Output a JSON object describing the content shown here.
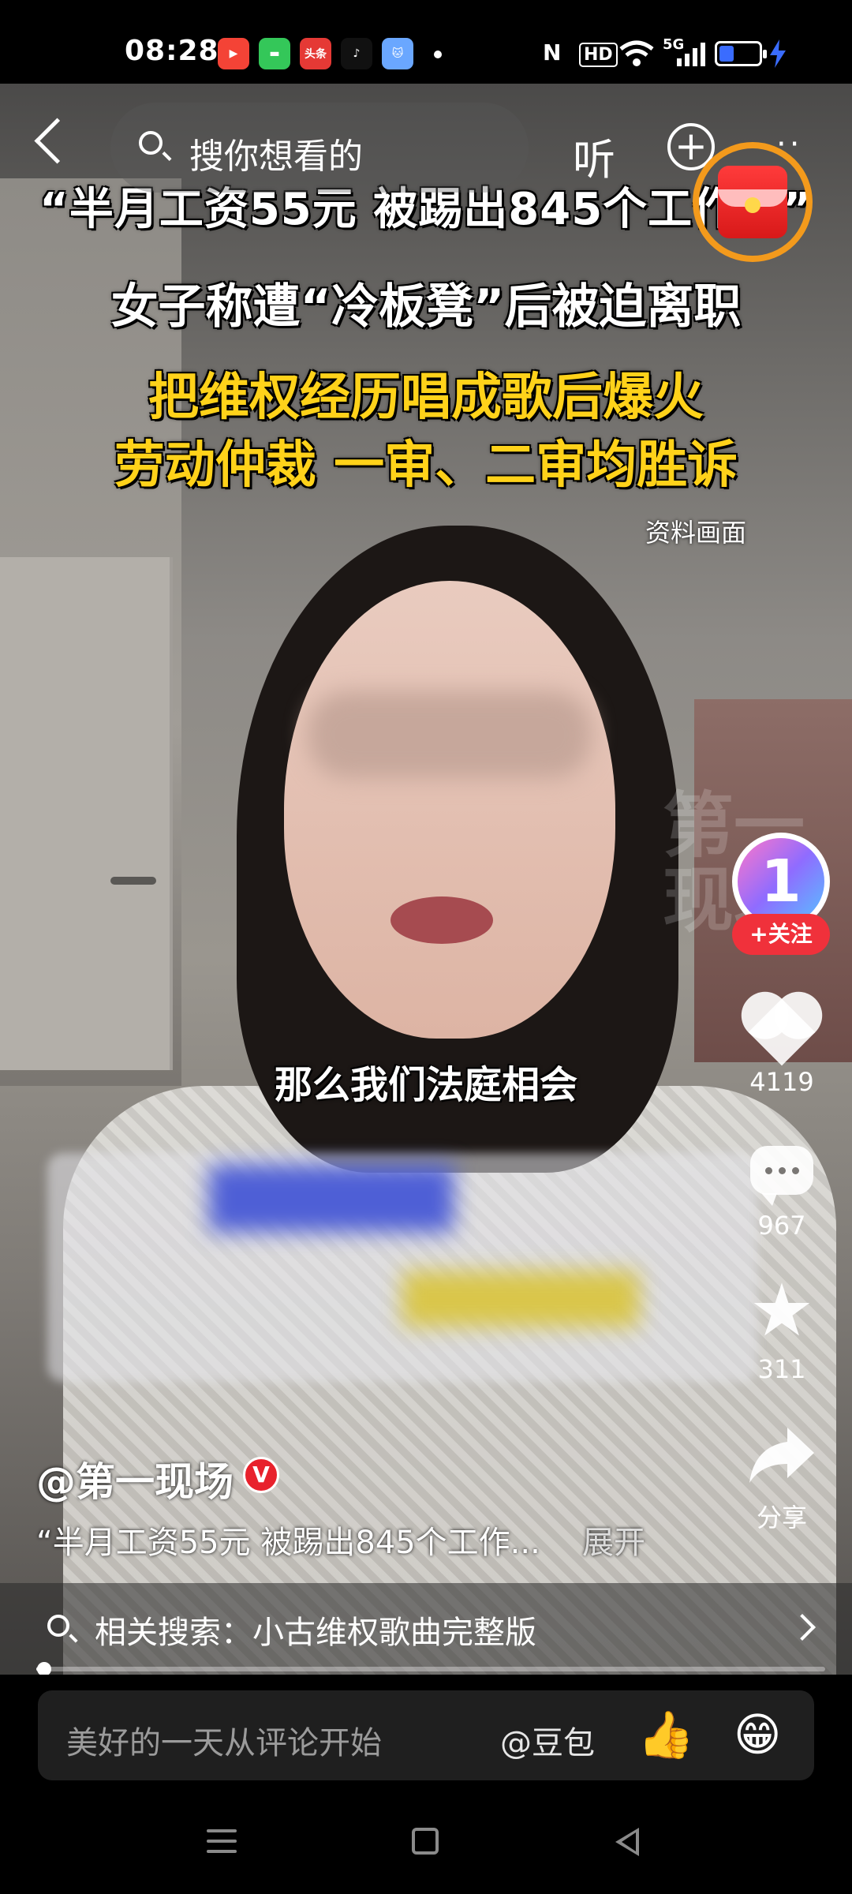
{
  "status_bar": {
    "time": "08:28",
    "app_icons": [
      {
        "name": "video-app-icon",
        "color": "#f44336",
        "label": "▶"
      },
      {
        "name": "message-app-icon",
        "color": "#34c759",
        "label": "▬"
      },
      {
        "name": "toutiao-app-icon",
        "color": "#e53935",
        "label": "头条"
      },
      {
        "name": "tiktok-app-icon",
        "color": "#111111",
        "label": "♪"
      },
      {
        "name": "cat-app-icon",
        "color": "#6aa7ff",
        "label": "🐱"
      }
    ],
    "nfc": "N",
    "hd": "HD",
    "signal": "5G"
  },
  "top_bar": {
    "search_placeholder": "搜你想看的",
    "listen_label": "听"
  },
  "video": {
    "headline_1": "“半月工资55元 被踢出845个工作群”",
    "headline_2": "女子称遭“冷板凳”后被迫离职",
    "headline_3": "把维权经历唱成歌后爆火",
    "headline_4": "劳动仲裁 一审、二审均胜诉",
    "tag": "资料画面",
    "subtitle": "那么我们法庭相会",
    "watermark": "第一现场"
  },
  "right_rail": {
    "avatar_text": "1",
    "follow_label": "+关注",
    "likes": "4119",
    "comments": "967",
    "favorites": "311",
    "share_label": "分享"
  },
  "post": {
    "author": "@第一现场",
    "verified": "V",
    "description": "“半月工资55元 被踢出845个工作...",
    "expand_label": "展开"
  },
  "related_search": {
    "text": "相关搜索：小古维权歌曲完整版"
  },
  "playback": {
    "progress_fraction": 0.01
  },
  "comment_bar": {
    "placeholder": "美好的一天从评论开始",
    "at_label": "@豆包",
    "thumb": "👍",
    "emoji": "😁"
  }
}
